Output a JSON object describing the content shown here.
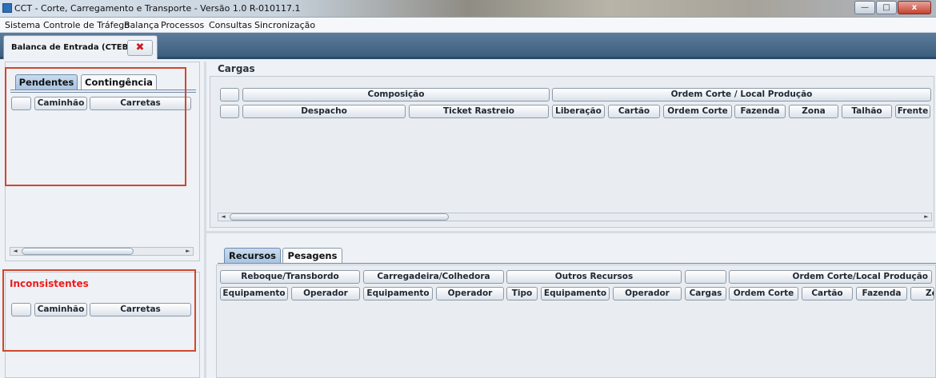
{
  "window": {
    "title": "CCT - Corte, Carregamento e Transporte - Versão 1.0 R-010117.1",
    "minimize": "—",
    "maximize": "□",
    "close": "x"
  },
  "menu": [
    "Sistema",
    "Controle de Tráfego",
    "Balança",
    "Processos",
    "Consultas",
    "Sincronização"
  ],
  "main_tab": {
    "label": "Balanca de Entrada (CTEBE)",
    "close": "✖"
  },
  "left": {
    "tabs": [
      "Pendentes",
      "Contingência"
    ],
    "columns": [
      "",
      "Caminhão",
      "Carretas"
    ],
    "inconsistentes": {
      "label": "Inconsistentes",
      "label_color": "#ee1c1c",
      "columns": [
        "",
        "Caminhão",
        "Carretas"
      ]
    }
  },
  "cargas": {
    "label": "Cargas",
    "groups": [
      "",
      "Composição",
      "Ordem Corte / Local Produção"
    ],
    "columns": [
      "",
      "Despacho",
      "Ticket Rastreio",
      "Liberação",
      "Cartão",
      "Ordem Corte",
      "Fazenda",
      "Zona",
      "Talhão",
      "Frente"
    ]
  },
  "bottom": {
    "tabs": [
      "Recursos",
      "Pesagens"
    ],
    "groups": [
      "Reboque/Transbordo",
      "Carregadeira/Colhedora",
      "Outros Recursos",
      "",
      "Ordem Corte/Local Produção"
    ],
    "columns": [
      "Equipamento",
      "Operador",
      "Equipamento",
      "Operador",
      "Tipo",
      "Equipamento",
      "Operador",
      "Cargas",
      "Ordem Corte",
      "Cartão",
      "Fazenda",
      "Zo"
    ]
  },
  "colors": {
    "highlight_box": "#d0472f",
    "tab_strip": "#4a6a8a"
  },
  "icons": [
    "app-icon",
    "close-icon",
    "scroll-left-icon",
    "scroll-right-icon"
  ]
}
